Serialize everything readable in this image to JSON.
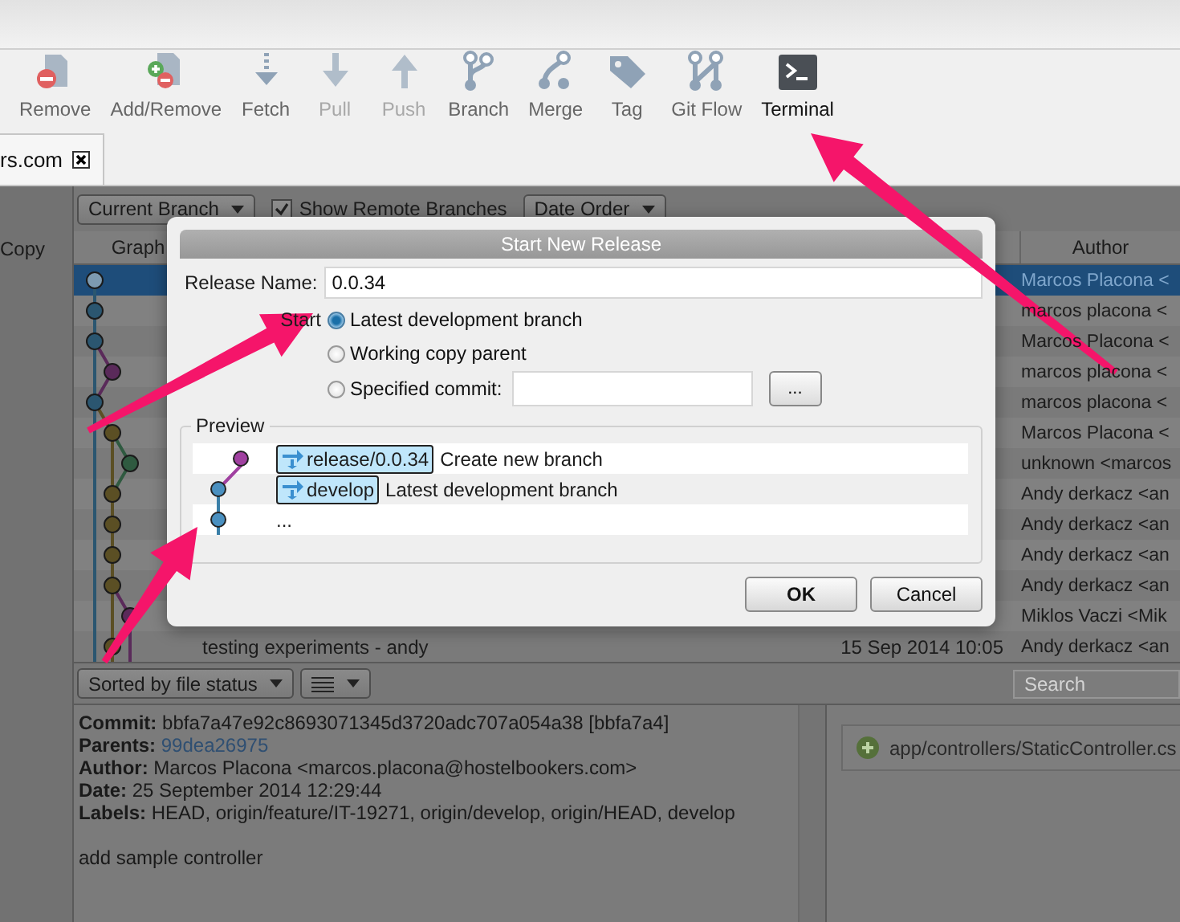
{
  "toolbar": [
    {
      "label": "Remove",
      "kind": "remove",
      "disabled": false
    },
    {
      "label": "Add/Remove",
      "kind": "addremove",
      "disabled": false
    },
    {
      "label": "Fetch",
      "kind": "fetch",
      "disabled": false
    },
    {
      "label": "Pull",
      "kind": "pull",
      "disabled": true
    },
    {
      "label": "Push",
      "kind": "push",
      "disabled": true
    },
    {
      "label": "Branch",
      "kind": "branch",
      "disabled": false
    },
    {
      "label": "Merge",
      "kind": "merge",
      "disabled": false
    },
    {
      "label": "Tag",
      "kind": "tag",
      "disabled": false
    },
    {
      "label": "Git Flow",
      "kind": "gitflow",
      "disabled": false
    },
    {
      "label": "Terminal",
      "kind": "terminal",
      "disabled": false
    }
  ],
  "tab": {
    "label": "rs.com"
  },
  "sidebar": {
    "items": [
      {
        "label": "Copy"
      }
    ]
  },
  "log_toolbar": {
    "branch_filter": "Current Branch",
    "show_remote_branches": {
      "label": "Show Remote Branches",
      "checked": true
    },
    "order": "Date Order"
  },
  "table": {
    "columns": [
      "Graph",
      "Author"
    ],
    "rows": [
      {
        "author": "Marcos Placona <",
        "selected": true
      },
      {
        "author": "marcos placona <",
        "selected": false
      },
      {
        "author": "Marcos Placona <",
        "selected": false
      },
      {
        "author": "marcos placona <",
        "selected": false
      },
      {
        "author": "marcos placona <",
        "selected": false
      },
      {
        "author": "Marcos Placona <",
        "selected": false
      },
      {
        "author": "unknown <marcos",
        "selected": false
      },
      {
        "author": "Andy derkacz <an",
        "selected": false
      },
      {
        "author": "Andy derkacz <an",
        "selected": false
      },
      {
        "author": "Andy derkacz <an",
        "selected": false
      },
      {
        "author": "Andy derkacz <an",
        "selected": false
      },
      {
        "author": "Miklos Vaczi <Mik",
        "selected": false
      },
      {
        "description": "testing experiments - andy",
        "date": "15 Sep 2014 10:05",
        "author": "Andy derkacz <an",
        "selected": false
      }
    ]
  },
  "files_toolbar": {
    "sort": "Sorted by file status",
    "search": {
      "placeholder": "Search"
    }
  },
  "details": {
    "lines": [
      {
        "label": "Commit:",
        "value": "bbfa7a47e92c8693071345d3720adc707a054a38 [bbfa7a4]",
        "kind": "text"
      },
      {
        "label": "Parents:",
        "value": "99dea26975",
        "kind": "link"
      },
      {
        "label": "Author:",
        "value": "Marcos Placona <marcos.placona@hostelbookers.com>",
        "kind": "text"
      },
      {
        "label": "Date:",
        "value": "25 September 2014 12:29:44",
        "kind": "text"
      },
      {
        "label": "Labels:",
        "value": "HEAD, origin/feature/IT-19271, origin/develop, origin/HEAD, develop",
        "kind": "text"
      }
    ],
    "message": "add sample controller"
  },
  "files": [
    {
      "path": "app/controllers/StaticController.cs",
      "kind": "added"
    }
  ],
  "dialog": {
    "title": "Start New Release",
    "release_name": {
      "label": "Release Name:",
      "value": "0.0.34"
    },
    "start_label": "Start",
    "options": [
      {
        "label": "Latest development branch",
        "selected": true
      },
      {
        "label": "Working copy parent",
        "selected": false
      },
      {
        "label": "Specified commit:",
        "selected": false,
        "kind": "commit"
      }
    ],
    "browse_button": "...",
    "preview": {
      "title": "Preview",
      "rows": [
        {
          "branch": "release/0.0.34",
          "text": "Create new branch"
        },
        {
          "branch": "develop",
          "text": "Latest development branch"
        },
        {
          "text": "..."
        }
      ]
    },
    "buttons": [
      {
        "label": "OK",
        "kind": "default"
      },
      {
        "label": "Cancel",
        "kind": "normal"
      }
    ]
  }
}
